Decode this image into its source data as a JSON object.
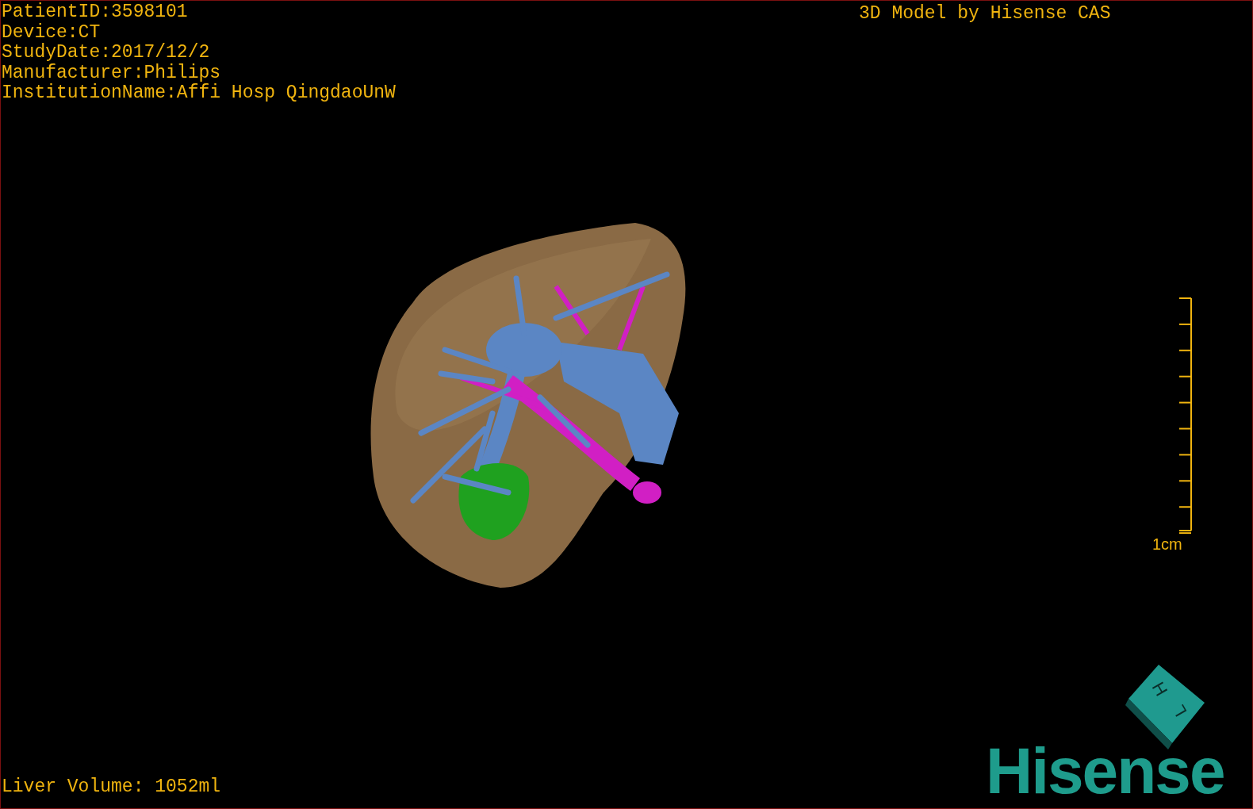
{
  "info_lines": [
    "PatientID:3598101",
    "Device:CT",
    "StudyDate:2017/12/2",
    "Manufacturer:Philips",
    "InstitutionName:Affi Hosp QingdaoUnW"
  ],
  "title": "3D Model by Hisense CAS",
  "scale_bar": {
    "label": "1cm"
  },
  "orientation_cube": {
    "labels": [
      "H",
      "L"
    ]
  },
  "logo": {
    "text": "Hisense"
  },
  "footer": {
    "text": "Liver Volume: 1052ml"
  }
}
